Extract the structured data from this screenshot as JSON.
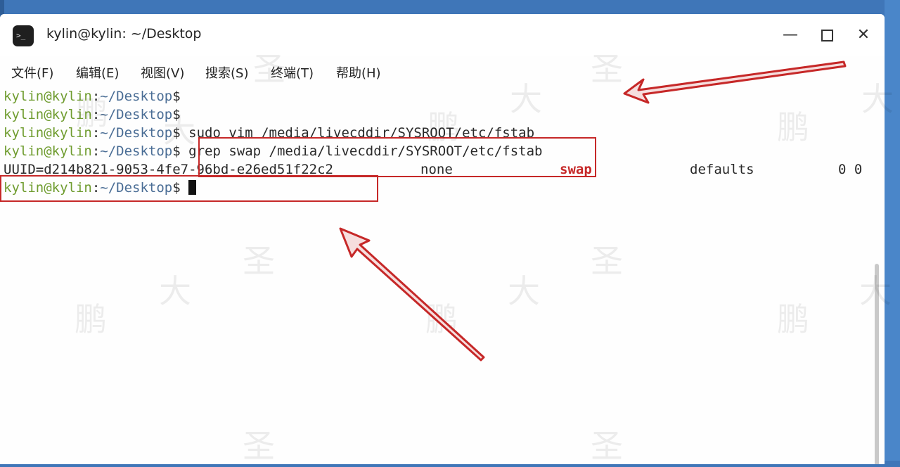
{
  "window": {
    "title": "kylin@kylin: ~/Desktop",
    "icon": "terminal-icon",
    "icon_glyph": ">_",
    "controls": {
      "minimize": "—",
      "close": "✕"
    }
  },
  "menu": [
    {
      "label": "文件(F)"
    },
    {
      "label": "编辑(E)"
    },
    {
      "label": "视图(V)"
    },
    {
      "label": "搜索(S)"
    },
    {
      "label": "终端(T)"
    },
    {
      "label": "帮助(H)"
    }
  ],
  "prompt": {
    "user": "kylin@kylin",
    "sep": ":",
    "path": "~/Desktop",
    "dollar": "$"
  },
  "lines": [
    {
      "cmd": ""
    },
    {
      "cmd": ""
    },
    {
      "cmd": " sudo vim /media/livecddir/SYSROOT/etc/fstab"
    },
    {
      "cmd": " grep swap /media/livecddir/SYSROOT/etc/fstab"
    }
  ],
  "fstab_entry": {
    "device": "UUID=d214b821-9053-4fe7-96bd-e26ed51f22c2",
    "mount": "none",
    "type": "swap",
    "options": "defaults",
    "dump_pass": "0 0"
  },
  "last_prompt_cmd": " ",
  "watermark_chars": [
    "鹏",
    "大",
    "圣"
  ],
  "colors": {
    "annotation_red": "#c62828",
    "prompt_user": "#6f9c2f",
    "prompt_path": "#4a6d95"
  }
}
